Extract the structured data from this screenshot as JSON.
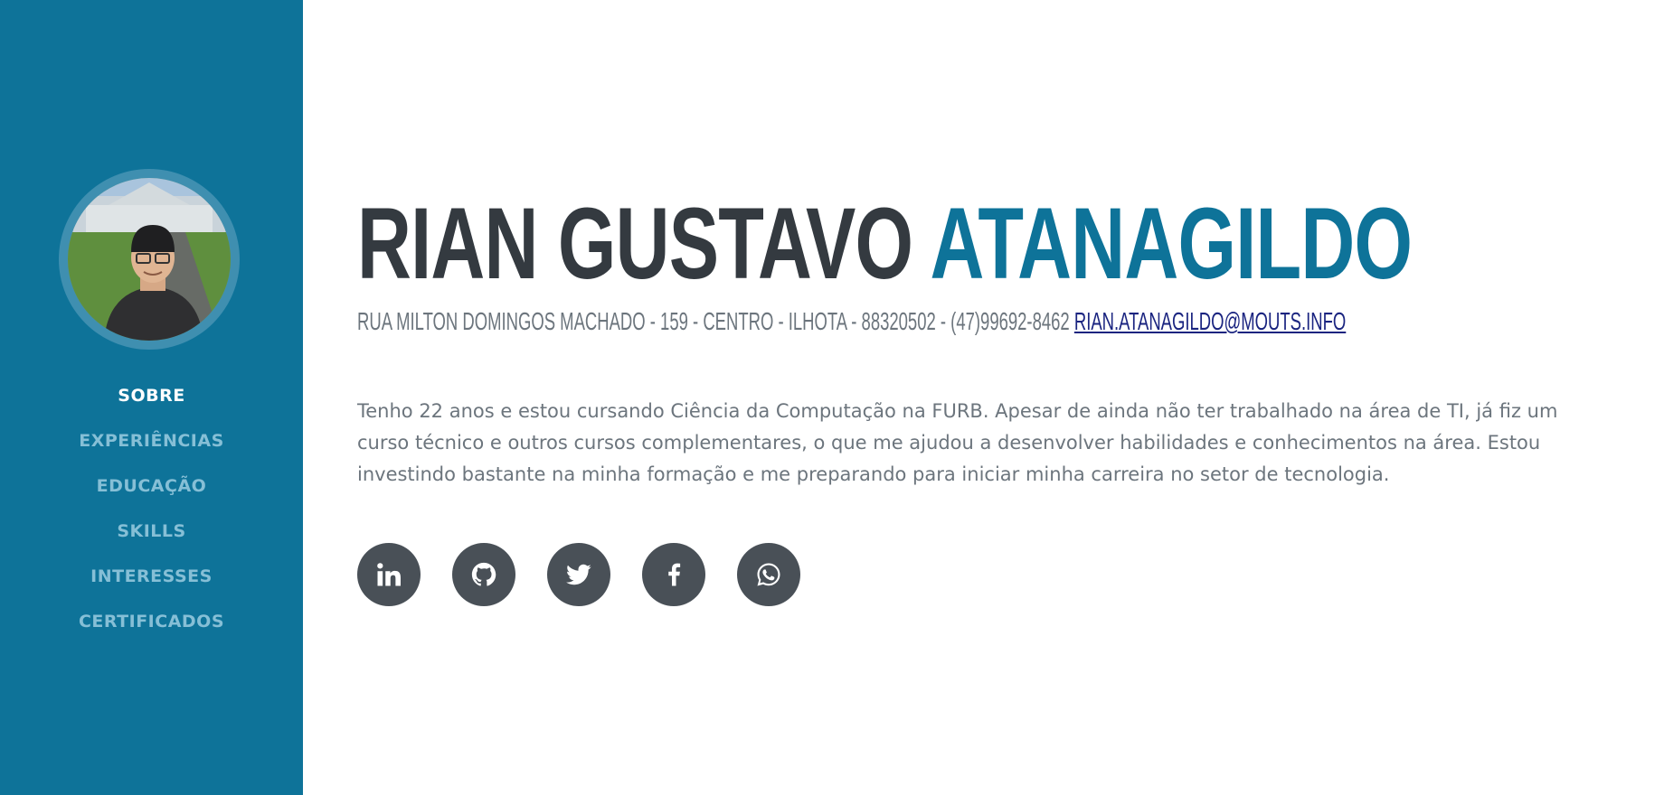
{
  "profile": {
    "photo_alt": "Profile photo"
  },
  "nav": {
    "items": [
      {
        "label": "SOBRE",
        "active": true
      },
      {
        "label": "EXPERIÊNCIAS",
        "active": false
      },
      {
        "label": "EDUCAÇÃO",
        "active": false
      },
      {
        "label": "SKILLS",
        "active": false
      },
      {
        "label": "INTERESSES",
        "active": false
      },
      {
        "label": "CERTIFICADOS",
        "active": false
      }
    ]
  },
  "header": {
    "first_name": "RIAN GUSTAVO",
    "last_name": "ATANAGILDO",
    "contact_text": "RUA MILTON DOMINGOS MACHADO - 159 - CENTRO - ILHOTA - 88320502 - (47)99692-8462",
    "email": "RIAN.ATANAGILDO@MOUTS.INFO"
  },
  "bio": "Tenho 22 anos e estou cursando Ciência da Computação na FURB. Apesar de ainda não ter trabalhado na área de TI, já fiz um curso técnico e outros cursos complementares, o que me ajudou a desenvolver habilidades e conhecimentos na área. Estou investindo bastante na minha formação e me preparando para iniciar minha carreira no setor de tecnologia.",
  "social": [
    {
      "icon": "linkedin-icon"
    },
    {
      "icon": "github-icon"
    },
    {
      "icon": "twitter-icon"
    },
    {
      "icon": "facebook-icon"
    },
    {
      "icon": "whatsapp-icon"
    }
  ],
  "colors": {
    "primary": "#0e7399",
    "nav_inactive": "#86bfd6",
    "heading": "#343a40",
    "text": "#6c757d",
    "social_bg": "#495057",
    "email_link": "#1a2480"
  }
}
